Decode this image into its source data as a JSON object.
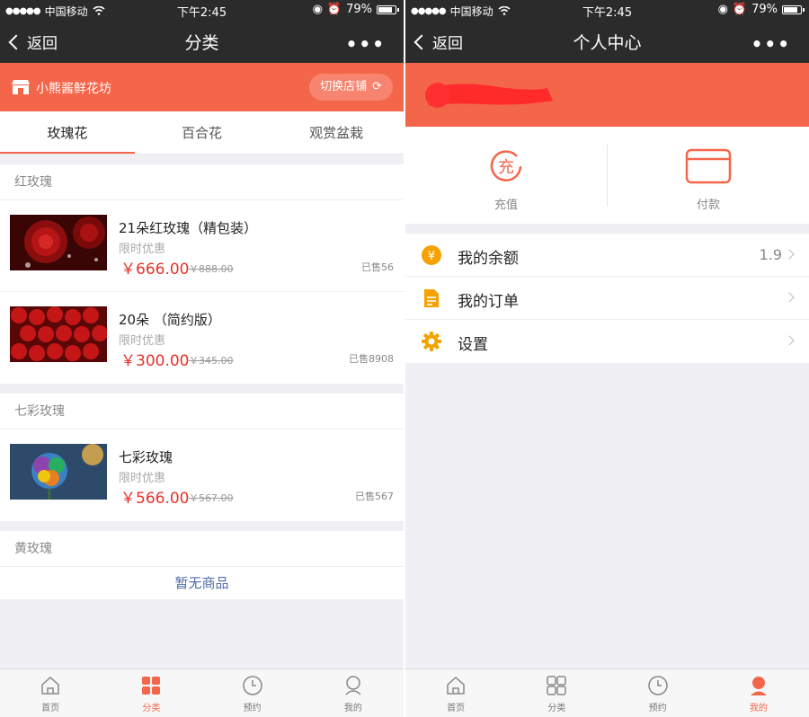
{
  "status_bar": {
    "carrier": "中国移动",
    "time": "下午2:45",
    "battery": "79%"
  },
  "left": {
    "nav": {
      "back": "返回",
      "title": "分类",
      "more": "•••"
    },
    "store": {
      "name": "小熊酱鲜花坊",
      "switch_label": "切换店铺"
    },
    "tabs": [
      "玫瑰花",
      "百合花",
      "观赏盆栽"
    ],
    "sections": [
      {
        "title": "红玫瑰",
        "products": [
          {
            "name": "21朵红玫瑰（精包装）",
            "promo": "限时优惠",
            "price": "￥666.00",
            "orig": "￥888.00",
            "sold": "已售56"
          },
          {
            "name": "20朵 （简约版）",
            "promo": "限时优惠",
            "price": "￥300.00",
            "orig": "￥345.00",
            "sold": "已售8908"
          }
        ]
      },
      {
        "title": "七彩玫瑰",
        "products": [
          {
            "name": "七彩玫瑰",
            "promo": "限时优惠",
            "price": "￥566.00",
            "orig": "￥567.00",
            "sold": "已售567"
          }
        ]
      },
      {
        "title": "黄玫瑰",
        "empty": "暂无商品"
      }
    ],
    "tabbar": [
      {
        "label": "首页",
        "icon": "home-icon"
      },
      {
        "label": "分类",
        "icon": "grid-icon"
      },
      {
        "label": "预约",
        "icon": "clock-icon"
      },
      {
        "label": "我的",
        "icon": "user-icon"
      }
    ],
    "tabbar_active": 1
  },
  "right": {
    "nav": {
      "back": "返回",
      "title": "个人中心",
      "more": "•••"
    },
    "actions": [
      {
        "label": "充值",
        "icon": "recharge-icon",
        "glyph": "充"
      },
      {
        "label": "付款",
        "icon": "card-icon"
      }
    ],
    "menu": [
      {
        "label": "我的余额",
        "value": "1.9",
        "icon": "yen-coin-icon"
      },
      {
        "label": "我的订单",
        "icon": "document-icon"
      },
      {
        "label": "设置",
        "icon": "gear-icon"
      }
    ],
    "tabbar": [
      {
        "label": "首页",
        "icon": "home-icon"
      },
      {
        "label": "分类",
        "icon": "grid-icon"
      },
      {
        "label": "预约",
        "icon": "clock-icon"
      },
      {
        "label": "我的",
        "icon": "user-icon"
      }
    ],
    "tabbar_active": 3
  },
  "colors": {
    "accent": "#f4664a",
    "price": "#e8322a",
    "nav_bg": "#2b2b2b",
    "empty_link": "#4e6ea8",
    "menu_icon": "#f5a200"
  }
}
